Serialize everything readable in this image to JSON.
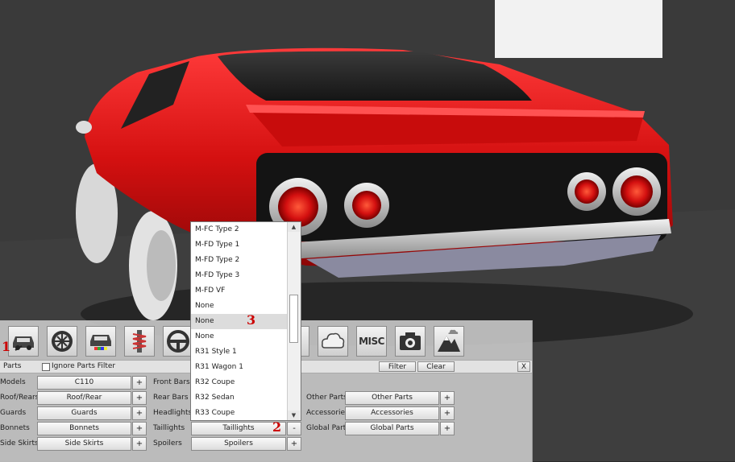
{
  "annotations": {
    "one": "1",
    "two": "2",
    "three": "3"
  },
  "toolbar_icons": [
    "body-parts-icon",
    "wheel-icon",
    "paint-icon",
    "suspension-icon",
    "steering-icon",
    "unknown-icon",
    "smoke-icon",
    "misc-icon",
    "camera-icon",
    "environment-icon"
  ],
  "misc_label": "MISC",
  "parts_header": {
    "parts_label": "Parts",
    "ignore_filter_label": "Ignore Parts Filter",
    "filter_button": "Filter",
    "clear_button": "Clear",
    "close_button": "X"
  },
  "left_column": [
    {
      "label": "Models",
      "value": "C110",
      "plus": "+"
    },
    {
      "label": "Roof/Rears",
      "value": "Roof/Rear",
      "plus": "+"
    },
    {
      "label": "Guards",
      "value": "Guards",
      "plus": "+"
    },
    {
      "label": "Bonnets",
      "value": "Bonnets",
      "plus": "+"
    },
    {
      "label": "Side Skirts",
      "value": "Side Skirts",
      "plus": "+"
    }
  ],
  "middle_column": [
    {
      "label": "Front Bars"
    },
    {
      "label": "Rear Bars"
    },
    {
      "label": "Headlights"
    },
    {
      "label": "Taillights",
      "value": "Taillights",
      "minus": "-"
    },
    {
      "label": "Spoilers",
      "value": "Spoilers",
      "plus": "+"
    }
  ],
  "right_column": [
    {
      "label": "Other Parts",
      "value": "Other Parts",
      "plus": "+"
    },
    {
      "label": "Accessories",
      "value": "Accessories",
      "plus": "+"
    },
    {
      "label": "Global Parts",
      "value": "Global Parts",
      "plus": "+"
    }
  ],
  "dropdown": {
    "options": [
      "M-FC Type 2",
      "M-FD Type 1",
      "M-FD Type 2",
      "M-FD Type 3",
      "M-FD VF",
      "None",
      "None",
      "None",
      "R31 Style 1",
      "R31 Wagon 1",
      "R32 Coupe",
      "R32 Sedan",
      "R33 Coupe"
    ],
    "selected_index": 6,
    "scroll_up": "▲",
    "scroll_down": "▼"
  },
  "colors": {
    "car_body": "#d41010",
    "panel_bg": "#cdcdcd",
    "annotation": "#cc0000"
  }
}
